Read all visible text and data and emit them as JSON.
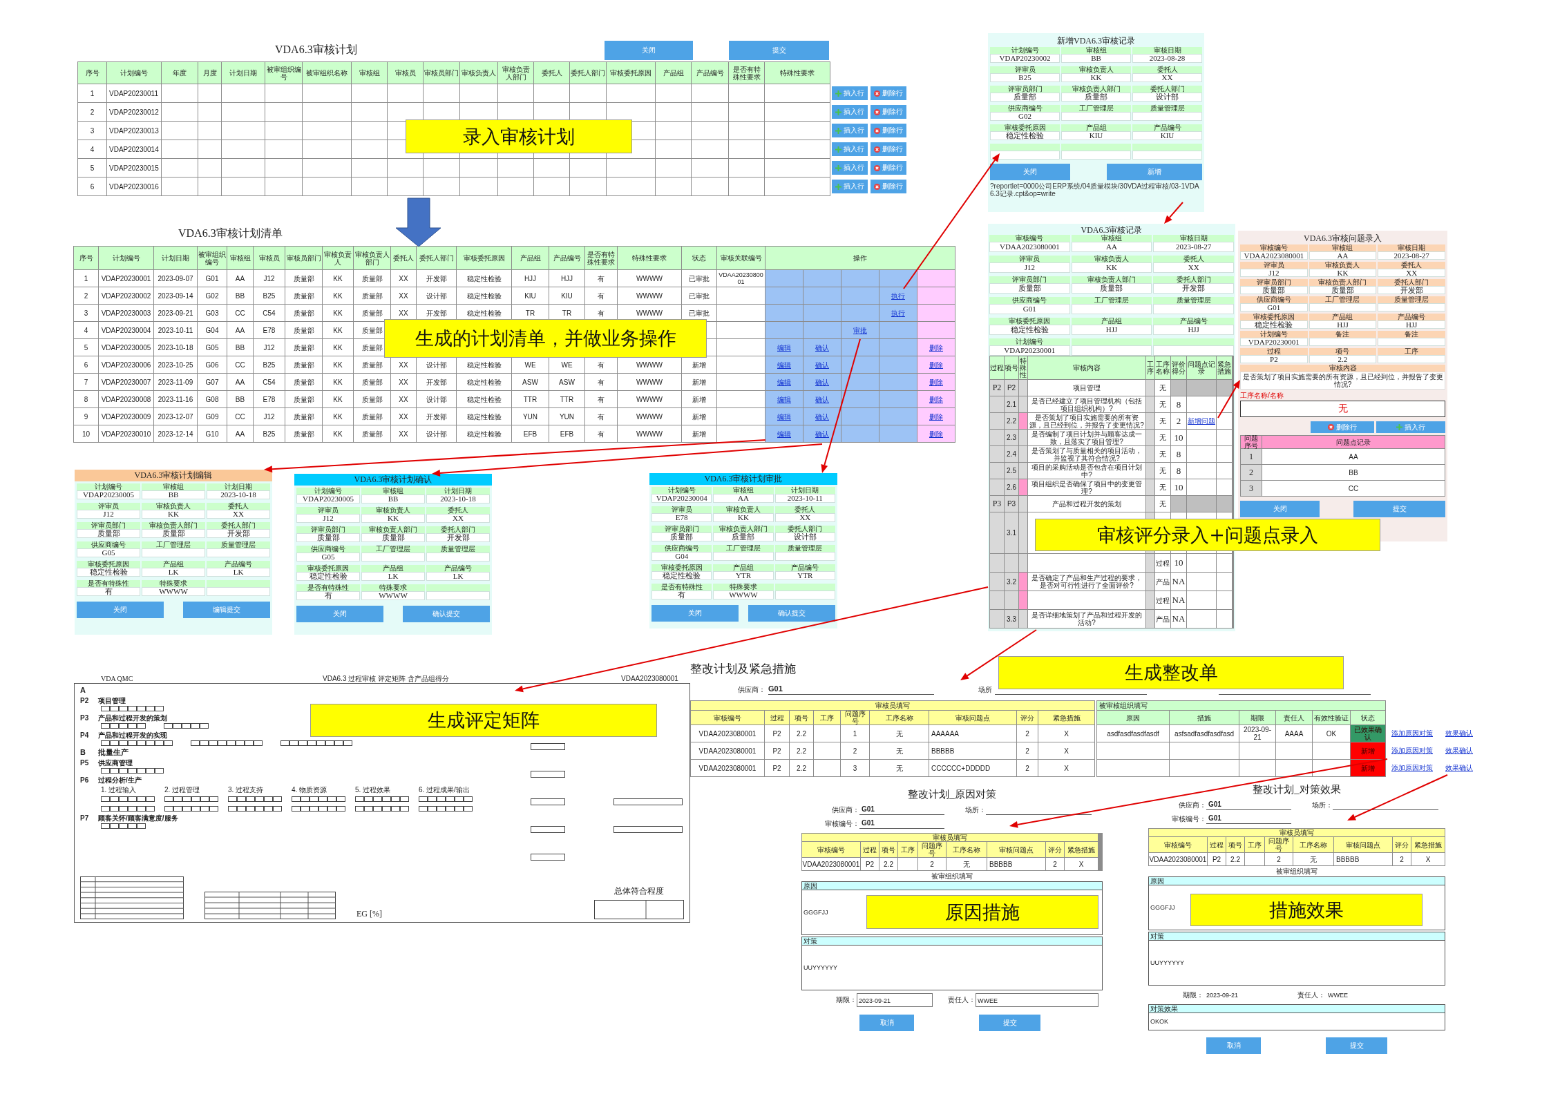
{
  "plan_entry": {
    "title": "VDA6.3审核计划",
    "buttons": [
      "关闭",
      "提交"
    ],
    "columns": [
      "序号",
      "计划编号",
      "年度",
      "月度",
      "计划日期",
      "被审组织编号",
      "被审组织名称",
      "审核组",
      "审核员",
      "审核员部门",
      "审核负责人",
      "审核负责人部门",
      "委托人",
      "委托人部门",
      "审核委托原因",
      "产品组",
      "产品编号",
      "是否有特殊性要求",
      "特殊性要求"
    ],
    "rows": [
      {
        "cells": [
          "1",
          "VDAP20230011"
        ],
        "actions": [
          "插入行",
          "删除行"
        ]
      },
      {
        "cells": [
          "2",
          "VDAP20230012"
        ],
        "actions": [
          "插入行",
          "删除行"
        ]
      },
      {
        "cells": [
          "3",
          "VDAP20230013"
        ],
        "actions": [
          "插入行",
          "删除行"
        ]
      },
      {
        "cells": [
          "4",
          "VDAP20230014"
        ],
        "actions": [
          "插入行",
          "删除行"
        ]
      },
      {
        "cells": [
          "5",
          "VDAP20230015"
        ],
        "actions": [
          "插入行",
          "删除行"
        ]
      },
      {
        "cells": [
          "6",
          "VDAP20230016"
        ],
        "actions": [
          "插入行",
          "删除行"
        ]
      }
    ]
  },
  "record_new": {
    "title": "新增VDA6.3审核记录",
    "fields": [
      {
        "label": "计划编号",
        "value": "VDAP20230002"
      },
      {
        "label": "审核组",
        "value": "BB"
      },
      {
        "label": "审核日期",
        "value": "2023-08-28"
      },
      {
        "label": "评审员",
        "value": "B25"
      },
      {
        "label": "审核负责人",
        "value": "KK"
      },
      {
        "label": "委托人",
        "value": "XX"
      },
      {
        "label": "评审员部门",
        "value": "质量部"
      },
      {
        "label": "审核负责人部门",
        "value": "质量部"
      },
      {
        "label": "委托人部门",
        "value": "设计部"
      },
      {
        "label": "供应商编号",
        "value": "G02"
      },
      {
        "label": "工厂管理层"
      },
      {
        "label": "质量管理层"
      },
      {
        "label": "审核委托原因",
        "value": "稳定性检验"
      },
      {
        "label": "产品组",
        "value": "KIU"
      },
      {
        "label": "产品编号",
        "value": "KIU"
      }
    ],
    "blank_row": true,
    "buttons": [
      "关闭",
      "新增"
    ],
    "url": "?reportlet=0000公司ERP系统/04质量模块/30VDA过程审核/03-1VDA6.3记录.cpt&op=write"
  },
  "plan_list": {
    "title": "VDA6.3审核计划清单",
    "columns": [
      "序号",
      "计划编号",
      "计划日期",
      "被审组织编号",
      "审核组",
      "审核员",
      "审核员部门",
      "审核负责人",
      "审核负责人部门",
      "委托人",
      "委托人部门",
      "审核委托原因",
      "产品组",
      "产品编号",
      "是否有特殊性要求",
      "特殊性要求",
      "状态",
      "审核关联编号",
      "操作"
    ],
    "rows": [
      {
        "cells": [
          "1",
          "VDAP20230001",
          "2023-09-07",
          "G01",
          "AA",
          "J12",
          "质量部",
          "KK",
          "质量部",
          "XX",
          "开发部",
          "稳定性检验",
          "HJJ",
          "HJJ",
          "有",
          "WWWW",
          "已审批",
          "VDAA2023080001"
        ]
      },
      {
        "cells": [
          "2",
          "VDAP20230002",
          "2023-09-14",
          "G02",
          "BB",
          "B25",
          "质量部",
          "KK",
          "质量部",
          "XX",
          "设计部",
          "稳定性检验",
          "KIU",
          "KIU",
          "有",
          "WWWW",
          "已审批"
        ],
        "ops": [
          {
            "kind": "execute",
            "label": "执行"
          }
        ]
      },
      {
        "cells": [
          "3",
          "VDAP20230003",
          "2023-09-21",
          "G03",
          "CC",
          "C54",
          "质量部",
          "KK",
          "质量部",
          "XX",
          "开发部",
          "稳定性检验",
          "TR",
          "TR",
          "有",
          "WWWW",
          "已审批"
        ],
        "ops": [
          {
            "kind": "execute",
            "label": "执行"
          }
        ]
      },
      {
        "cells": [
          "4",
          "VDAP20230004",
          "2023-10-11",
          "G04",
          "AA",
          "E78",
          "质量部",
          "KK",
          "质量部"
        ],
        "ops": [
          {
            "kind": "approve",
            "label": "审批"
          }
        ]
      },
      {
        "cells": [
          "5",
          "VDAP20230005",
          "2023-10-18",
          "G05",
          "BB",
          "J12",
          "质量部",
          "KK",
          "质量部"
        ],
        "ops": [
          {
            "kind": "edit",
            "label": "编辑"
          },
          {
            "kind": "confirm",
            "label": "确认"
          },
          {
            "kind": "delete",
            "label": "删除"
          }
        ]
      },
      {
        "cells": [
          "6",
          "VDAP20230006",
          "2023-10-25",
          "G06",
          "CC",
          "B25",
          "质量部",
          "KK",
          "质量部",
          "XX",
          "设计部",
          "稳定性检验",
          "WE",
          "WE",
          "有",
          "WWWW",
          "新增"
        ],
        "ops": [
          {
            "kind": "edit",
            "label": "编辑"
          },
          {
            "kind": "confirm",
            "label": "确认"
          },
          {
            "kind": "delete",
            "label": "删除"
          }
        ]
      },
      {
        "cells": [
          "7",
          "VDAP20230007",
          "2023-11-09",
          "G07",
          "AA",
          "C54",
          "质量部",
          "KK",
          "质量部",
          "XX",
          "开发部",
          "稳定性检验",
          "ASW",
          "ASW",
          "有",
          "WWWW",
          "新增"
        ],
        "ops": [
          {
            "kind": "edit",
            "label": "编辑"
          },
          {
            "kind": "confirm",
            "label": "确认"
          },
          {
            "kind": "delete",
            "label": "删除"
          }
        ]
      },
      {
        "cells": [
          "8",
          "VDAP20230008",
          "2023-11-16",
          "G08",
          "BB",
          "E78",
          "质量部",
          "KK",
          "质量部",
          "XX",
          "设计部",
          "稳定性检验",
          "TTR",
          "TTR",
          "有",
          "WWWW",
          "新增"
        ],
        "ops": [
          {
            "kind": "edit",
            "label": "编辑"
          },
          {
            "kind": "confirm",
            "label": "确认"
          },
          {
            "kind": "delete",
            "label": "删除"
          }
        ]
      },
      {
        "cells": [
          "9",
          "VDAP20230009",
          "2023-12-07",
          "G09",
          "CC",
          "J12",
          "质量部",
          "KK",
          "质量部",
          "XX",
          "开发部",
          "稳定性检验",
          "YUN",
          "YUN",
          "有",
          "WWWW",
          "新增"
        ],
        "ops": [
          {
            "kind": "edit",
            "label": "编辑"
          },
          {
            "kind": "confirm",
            "label": "确认"
          },
          {
            "kind": "delete",
            "label": "删除"
          }
        ]
      },
      {
        "cells": [
          "10",
          "VDAP20230010",
          "2023-12-14",
          "G10",
          "AA",
          "B25",
          "质量部",
          "KK",
          "质量部",
          "XX",
          "设计部",
          "稳定性检验",
          "EFB",
          "EFB",
          "有",
          "WWWW",
          "新增"
        ],
        "ops": [
          {
            "kind": "edit",
            "label": "编辑"
          },
          {
            "kind": "confirm",
            "label": "确认"
          },
          {
            "kind": "delete",
            "label": "删除"
          }
        ]
      }
    ]
  },
  "record": {
    "title": "VDA6.3审核记录",
    "fields": [
      {
        "label": "审核编号",
        "value": "VDAA2023080001"
      },
      {
        "label": "审核组",
        "value": "AA"
      },
      {
        "label": "审核日期",
        "value": "2023-08-27"
      },
      {
        "label": "评审员",
        "value": "J12"
      },
      {
        "label": "审核负责人",
        "value": "KK"
      },
      {
        "label": "委托人",
        "value": "XX"
      },
      {
        "label": "评审员部门",
        "value": "质量部"
      },
      {
        "label": "审核负责人部门",
        "value": "质量部"
      },
      {
        "label": "委托人部门",
        "value": "开发部"
      },
      {
        "label": "供应商编号",
        "value": "G01"
      },
      {
        "label": "工厂管理层"
      },
      {
        "label": "质量管理层"
      },
      {
        "label": "审核委托原因",
        "value": "稳定性检验"
      },
      {
        "label": "产品组",
        "value": "HJJ"
      },
      {
        "label": "产品编号",
        "value": "HJJ"
      },
      {
        "label": "计划编号",
        "value": "VDAP20230001"
      }
    ],
    "score_table": {
      "columns": [
        "过程",
        "项号",
        "特殊性",
        "审核内容",
        "工序",
        "工序名称",
        "评价得分",
        "问题点记录",
        "紧急措施"
      ],
      "rows": [
        {
          "kind": "group",
          "process": "P2",
          "item": "P2",
          "content": "项目管理",
          "step_name": "无"
        },
        {
          "kind": "question",
          "item": "2.1",
          "special": false,
          "content": "是否已经建立了项目管理机构（包括项目组织机构）?",
          "step_name": "无",
          "score": "8"
        },
        {
          "kind": "question",
          "item": "2.2",
          "special": true,
          "content": "是否策划了项目实施需要的所有资源，且已经到位，并报告了变更情况?",
          "step_name": "无",
          "score": "2",
          "issue_link": "新增问题"
        },
        {
          "kind": "question",
          "item": "2.3",
          "special": false,
          "content": "是否编制了项目计划并与顾客达成一致，且落实了项目管理?",
          "step_name": "无",
          "score": "10"
        },
        {
          "kind": "question",
          "item": "2.4",
          "special": false,
          "content": "是否策划了与质量相关的项目活动，并监视了其符合情况?",
          "step_name": "无",
          "score": "8"
        },
        {
          "kind": "question",
          "item": "2.5",
          "special": false,
          "content": "项目的采购活动是否包含在项目计划中?",
          "step_name": "无",
          "score": "8"
        },
        {
          "kind": "question",
          "item": "2.6",
          "special": true,
          "content": "项目组织是否确保了项目中的变更管理?",
          "step_name": "无",
          "score": "10"
        },
        {
          "kind": "group",
          "process": "P3",
          "item": "P3",
          "content": "产品和过程开发的策划",
          "step_name": "无"
        },
        {
          "kind": "question",
          "item": "3.1",
          "special": false
        },
        {
          "kind": "question",
          "special": false,
          "step_name": "过程",
          "score": "10"
        },
        {
          "kind": "question",
          "item": "3.2",
          "special": true,
          "content": "是否确定了产品和生产过程的要求，是否对可行性进行了全面评价?",
          "step_name": "产品",
          "score": "NA"
        },
        {
          "kind": "question",
          "special": true,
          "step_name": "过程",
          "score": "NA"
        },
        {
          "kind": "question",
          "item": "3.3",
          "special": false,
          "content": "是否详细地策划了产品和过程开发的活动?",
          "step_name": "产品",
          "score": "NA"
        }
      ]
    }
  },
  "issue_entry": {
    "title": "VDA6.3审核问题录入",
    "fields": [
      {
        "label": "审核编号",
        "value": "VDAA2023080001"
      },
      {
        "label": "审核组",
        "value": "AA"
      },
      {
        "label": "审核日期",
        "value": "2023-08-27"
      },
      {
        "label": "评审员",
        "value": "J12"
      },
      {
        "label": "审核负责人",
        "value": "KK"
      },
      {
        "label": "委托人",
        "value": "XX"
      },
      {
        "label": "评审员部门",
        "value": "质量部"
      },
      {
        "label": "审核负责人部门",
        "value": "质量部"
      },
      {
        "label": "委托人部门",
        "value": "开发部"
      },
      {
        "label": "供应商编号",
        "value": "G01"
      },
      {
        "label": "工厂管理层"
      },
      {
        "label": "质量管理层"
      },
      {
        "label": "审核委托原因",
        "value": "稳定性检验"
      },
      {
        "label": "产品组",
        "value": "HJJ"
      },
      {
        "label": "产品编号",
        "value": "HJJ"
      },
      {
        "label": "计划编号",
        "value": "VDAP20230001"
      },
      {
        "label": "备注"
      },
      {
        "label": "备注"
      },
      {
        "label": "过程",
        "value": "P2"
      },
      {
        "label": "项号",
        "value": "2.2"
      },
      {
        "label": "工序"
      }
    ],
    "content": {
      "label": "审核内容",
      "value": "是否策划了项目实施需要的所有资源，且已经到位，并报告了变更情况?"
    },
    "step": {
      "label": "工序名称/名称",
      "value": "无"
    },
    "row_buttons": [
      "删除行",
      "插入行"
    ],
    "issues": {
      "columns": [
        "问题序号",
        "问题点记录"
      ],
      "rows": [
        [
          "1",
          "AA"
        ],
        [
          "2",
          "BB"
        ],
        [
          "3",
          "CC"
        ]
      ]
    },
    "buttons": [
      "关闭",
      "提交"
    ]
  },
  "plan_forms": [
    {
      "title": "VDA6.3审核计划编辑",
      "color": "#fac898",
      "fields": [
        {
          "label": "计划编号",
          "value": "VDAP20230005"
        },
        {
          "label": "审核组",
          "value": "BB"
        },
        {
          "label": "计划日期",
          "value": "2023-10-18"
        },
        {
          "label": "评审员",
          "value": "J12"
        },
        {
          "label": "审核负责人",
          "value": "KK"
        },
        {
          "label": "委托人",
          "value": "XX"
        },
        {
          "label": "评审员部门",
          "value": "质量部"
        },
        {
          "label": "审核负责人部门",
          "value": "质量部"
        },
        {
          "label": "委托人部门",
          "value": "开发部"
        },
        {
          "label": "供应商编号",
          "value": "G05"
        },
        {
          "label": "工厂管理层"
        },
        {
          "label": "质量管理层"
        },
        {
          "label": "审核委托原因",
          "value": "稳定性检验"
        },
        {
          "label": "产品组",
          "value": "LK"
        },
        {
          "label": "产品编号",
          "value": "LK"
        },
        {
          "label": "是否有特殊性",
          "value": "有"
        },
        {
          "label": "特殊要求",
          "value": "WWWW"
        }
      ],
      "buttons": [
        "关闭",
        "编辑提交"
      ]
    },
    {
      "title": "VDA6.3审核计划确认",
      "color": "#00ccff",
      "fields": [
        {
          "label": "计划编号",
          "value": "VDAP20230005"
        },
        {
          "label": "审核组",
          "value": "BB"
        },
        {
          "label": "计划日期",
          "value": "2023-10-18"
        },
        {
          "label": "评审员",
          "value": "J12"
        },
        {
          "label": "审核负责人",
          "value": "KK"
        },
        {
          "label": "委托人",
          "value": "XX"
        },
        {
          "label": "评审员部门",
          "value": "质量部"
        },
        {
          "label": "审核负责人部门",
          "value": "质量部"
        },
        {
          "label": "委托人部门",
          "value": "开发部"
        },
        {
          "label": "供应商编号",
          "value": "G05"
        },
        {
          "label": "工厂管理层"
        },
        {
          "label": "质量管理层"
        },
        {
          "label": "审核委托原因",
          "value": "稳定性检验"
        },
        {
          "label": "产品组",
          "value": "LK"
        },
        {
          "label": "产品编号",
          "value": "LK"
        },
        {
          "label": "是否有特殊性",
          "value": "有"
        },
        {
          "label": "特殊要求",
          "value": "WWWW"
        }
      ],
      "buttons": [
        "关闭",
        "确认提交"
      ]
    },
    {
      "title": "VDA6.3审核计划审批",
      "color": "#00ccff",
      "fields": [
        {
          "label": "计划编号",
          "value": "VDAP20230004"
        },
        {
          "label": "审核组",
          "value": "AA"
        },
        {
          "label": "计划日期",
          "value": "2023-10-11"
        },
        {
          "label": "评审员",
          "value": "E78"
        },
        {
          "label": "审核负责人",
          "value": "KK"
        },
        {
          "label": "委托人",
          "value": "XX"
        },
        {
          "label": "评审员部门",
          "value": "质量部"
        },
        {
          "label": "审核负责人部门",
          "value": "质量部"
        },
        {
          "label": "委托人部门",
          "value": "设计部"
        },
        {
          "label": "供应商编号",
          "value": "G04"
        },
        {
          "label": "工厂管理层"
        },
        {
          "label": "质量管理层"
        },
        {
          "label": "审核委托原因",
          "value": "稳定性检验"
        },
        {
          "label": "产品组",
          "value": "YTR"
        },
        {
          "label": "产品编号",
          "value": "YTR"
        },
        {
          "label": "是否有特殊性",
          "value": "有"
        },
        {
          "label": "特殊要求",
          "value": "WWWW"
        }
      ],
      "buttons": [
        "关闭",
        "确认提交"
      ]
    }
  ],
  "rating_matrix": {
    "brand": "VDA QMC",
    "title": "VDA6.3 过程审核 评定矩阵 含产品组得分",
    "audit_no": "VDAA2023080001",
    "sections": [
      {
        "kind": "part",
        "code": "A"
      },
      {
        "kind": "process",
        "code": "P2",
        "name": "项目管理"
      },
      {
        "kind": "process",
        "code": "P3",
        "name": "产品和过程开发的策划"
      },
      {
        "kind": "process",
        "code": "P4",
        "name": "产品和过程开发的实现"
      },
      {
        "kind": "part",
        "code": "B",
        "name": "批量生产"
      },
      {
        "kind": "process",
        "code": "P5",
        "name": "供应商管理"
      },
      {
        "kind": "process",
        "code": "P6",
        "name": "过程分析/生产",
        "steps": [
          "1. 过程输入",
          "2. 过程管理",
          "3. 过程支持",
          "4. 物质资源",
          "5. 过程效果",
          "6. 过程成果/输出"
        ]
      },
      {
        "kind": "process",
        "code": "P7",
        "name": "顾客关怀/顾客满意度/服务"
      }
    ],
    "eg": "EG [%]",
    "overall": "总体符合程度"
  },
  "corrective_plan": {
    "title": "整改计划及紧急措施",
    "supplier": {
      "label": "供应商：",
      "value": "G01"
    },
    "site": {
      "label": "场所"
    },
    "groups": [
      "审核员填写",
      "被审核组织填写"
    ],
    "columns": [
      "审核编号",
      "过程",
      "项号",
      "工序",
      "问题序号",
      "工序名称",
      "审核问题点",
      "评分",
      "紧急措施"
    ],
    "response_columns": [
      "原因",
      "措施",
      "期限",
      "责任人",
      "有效性验证",
      "状态"
    ],
    "rows": [
      {
        "no": "VDAA2023080001",
        "process": "P2",
        "item": "2.2",
        "issue_no": "1",
        "step_name": "无",
        "issue": "AAAAAA",
        "score": "2",
        "action": "X",
        "response": [
          "asdfasdfasdfasdf",
          "asfsadfasdfasdfasd",
          "2023-09-21",
          "AAAA",
          "OK"
        ],
        "status": "已效果确认",
        "color": "#339966",
        "links": [
          "添加原因对策",
          "效果确认"
        ]
      },
      {
        "no": "VDAA2023080001",
        "process": "P2",
        "item": "2.2",
        "issue_no": "2",
        "step_name": "无",
        "issue": "BBBBB",
        "score": "2",
        "action": "X",
        "status": "新增",
        "color": "#ff0000",
        "links": [
          "添加原因对策",
          "效果确认"
        ]
      },
      {
        "no": "VDAA2023080001",
        "process": "P2",
        "item": "2.2",
        "issue_no": "3",
        "step_name": "无",
        "issue": "CCCCCC+DDDDD",
        "score": "2",
        "action": "X",
        "status": "新增",
        "color": "#ff0000",
        "links": [
          "添加原因对策",
          "效果确认"
        ]
      }
    ]
  },
  "cause_form": {
    "title": "整改计划_原因对策",
    "editable": true,
    "supplier": {
      "label": "供应商：",
      "value": "G01"
    },
    "site": {
      "label": "场所："
    },
    "audit_no": {
      "label": "审核编号：",
      "value": "G01"
    },
    "group": "审核员填写",
    "columns": [
      "审核编号",
      "过程",
      "项号",
      "工序",
      "问题序号",
      "工序名称",
      "审核问题点",
      "评分",
      "紧急措施"
    ],
    "row": {
      "no": "VDAA2023080001",
      "process": "P2",
      "item": "2.2",
      "issue_no": "2",
      "step_name": "无",
      "issue": "BBBBB",
      "score": "2",
      "action": "X"
    },
    "auditee_group": "被审组织填写",
    "cause": {
      "label": "原因",
      "value": "GGGFJJ"
    },
    "measure": {
      "label": "对策",
      "value": "UUYYYYYY"
    },
    "deadline": {
      "label": "期限：",
      "value": "2023-09-21"
    },
    "owner": {
      "label": "责任人：",
      "value": "WWEE"
    },
    "buttons": [
      "取消",
      "提交"
    ]
  },
  "effect_form": {
    "title": "整改计划_对策效果",
    "editable": false,
    "supplier": {
      "label": "供应商：",
      "value": "G01"
    },
    "site": {
      "label": "场所："
    },
    "audit_no": {
      "label": "审核编号：",
      "value": "G01"
    },
    "group": "审核员填写",
    "columns": [
      "审核编号",
      "过程",
      "项号",
      "工序",
      "问题序号",
      "工序名称",
      "审核问题点",
      "评分",
      "紧急措施"
    ],
    "row": {
      "no": "VDAA2023080001",
      "process": "P2",
      "item": "2.2",
      "issue_no": "2",
      "step_name": "无",
      "issue": "BBBBB",
      "score": "2",
      "action": "X"
    },
    "auditee_group": "被审组织填写",
    "cause": {
      "label": "原因",
      "value": "GGGFJJ"
    },
    "measure": {
      "label": "对策",
      "value": "UUYYYYYY"
    },
    "deadline": {
      "label": "期限：",
      "value": "2023-09-21"
    },
    "owner": {
      "label": "责任人：",
      "value": "WWEE"
    },
    "effect": {
      "label": "对策效果",
      "value": "OKOK"
    },
    "buttons": [
      "取消",
      "提交"
    ]
  },
  "callouts": [
    "录入审核计划",
    "生成的计划清单，并做业务操作",
    "审核评分录入+问题点录入",
    "生成评定矩阵",
    "生成整改单",
    "原因措施",
    "措施效果"
  ]
}
